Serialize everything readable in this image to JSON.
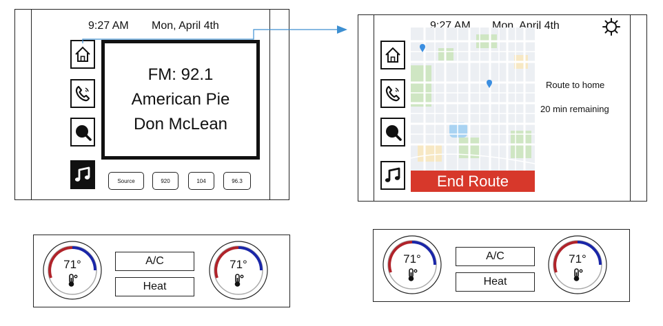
{
  "colors": {
    "accent_arrow": "#3d8fd1",
    "end_route": "#d7382b",
    "dial_warm": "#b0232a",
    "dial_cool": "#1a26a8",
    "map_park": "#cfe6c3",
    "map_water": "#a9d3f2",
    "map_road": "#ffffff",
    "map_base": "#eceff3",
    "map_pin": "#3b8ee0"
  },
  "icons": {
    "home": "home-icon",
    "phone": "phone-icon",
    "search": "search-icon",
    "music": "music-note-icon",
    "settings": "gear-icon",
    "thermometer": "thermometer-icon"
  },
  "radio_screen": {
    "time": "9:27 AM",
    "date": "Mon, April 4th",
    "station": "FM: 92.1",
    "song": "American Pie",
    "artist": "Don McLean",
    "presets": [
      "Source",
      "920",
      "104",
      "96.3"
    ]
  },
  "nav_screen": {
    "time": "9:27 AM",
    "date": "Mon, April 4th",
    "route_label": "Route to home",
    "remaining": "20 min remaining",
    "end_route_label": "End Route"
  },
  "climate_left": {
    "left_temp": "71°",
    "right_temp": "71°",
    "ac_label": "A/C",
    "heat_label": "Heat"
  },
  "climate_right": {
    "left_temp": "71°",
    "right_temp": "71°",
    "ac_label": "A/C",
    "heat_label": "Heat"
  }
}
